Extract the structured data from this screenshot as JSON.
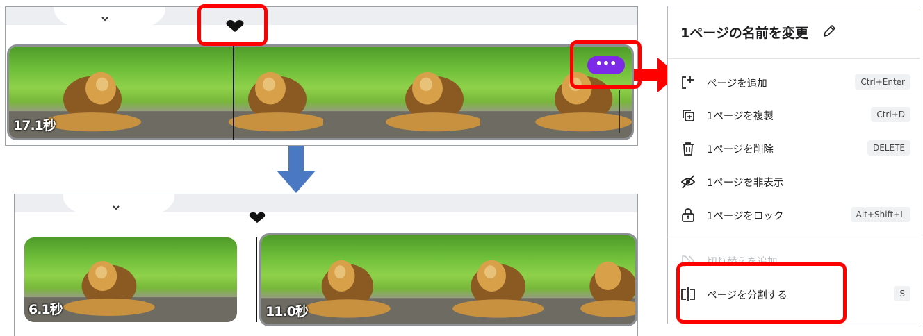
{
  "timeline_top": {
    "duration_label": "17.1秒",
    "more_button_label": "•••"
  },
  "timeline_bottom": {
    "page1_duration_label": "6.1秒",
    "page2_duration_label": "11.0秒"
  },
  "menu": {
    "title": "1ページの名前を変更",
    "items": [
      {
        "label": "ページを追加",
        "shortcut": "Ctrl+Enter",
        "icon": "add-page-icon"
      },
      {
        "label": "1ページを複製",
        "shortcut": "Ctrl+D",
        "icon": "duplicate-icon"
      },
      {
        "label": "1ページを削除",
        "shortcut": "DELETE",
        "icon": "trash-icon"
      },
      {
        "label": "1ページを非表示",
        "shortcut": "",
        "icon": "eye-off-icon"
      },
      {
        "label": "1ページをロック",
        "shortcut": "Alt+Shift+L",
        "icon": "lock-icon"
      },
      {
        "label": "切り替えを追加",
        "shortcut": "",
        "icon": "transition-icon",
        "disabled": true
      },
      {
        "label": "ページを分割する",
        "shortcut": "S",
        "icon": "split-icon"
      }
    ]
  },
  "colors": {
    "highlight": "#ff0000",
    "arrow_blue": "#4a78c2",
    "more_button": "#7d2ae8"
  }
}
